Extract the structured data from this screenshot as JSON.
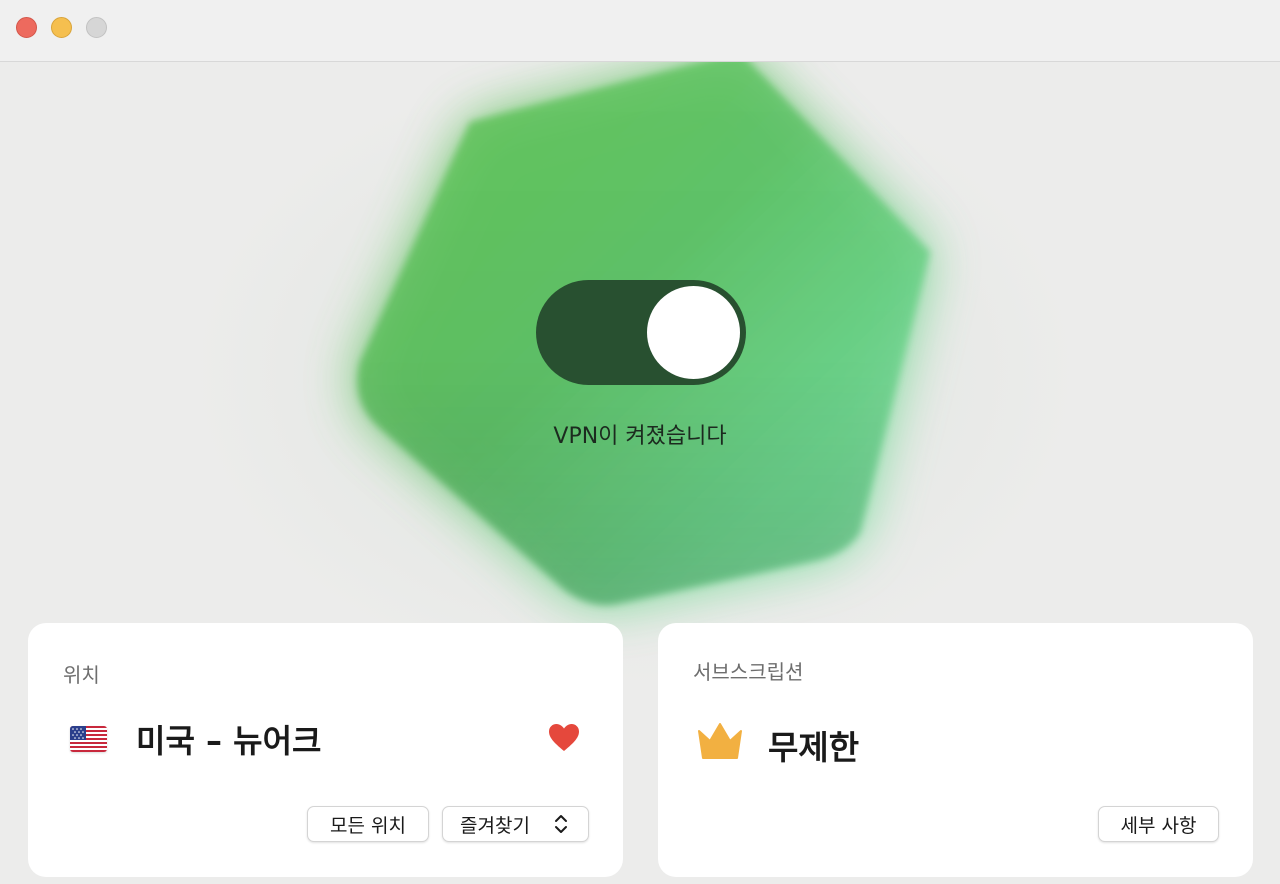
{
  "window": {
    "controls": [
      "close",
      "minimize",
      "zoom"
    ]
  },
  "vpn": {
    "toggle_state": "on",
    "status_text": "VPN이 켜졌습니다"
  },
  "location_card": {
    "label": "위치",
    "flag_icon": "us-flag-icon",
    "location_name": "미국 – 뉴어크",
    "favorite_icon": "heart-icon",
    "favorite_color": "#e5483c",
    "all_locations_button": "모든 위치",
    "favorites_button": "즐겨찾기"
  },
  "subscription_card": {
    "label": "서브스크립션",
    "plan_icon": "crown-icon",
    "plan_icon_color": "#f2b041",
    "plan_name": "무제한",
    "details_button": "세부 사항"
  },
  "colors": {
    "accent_green": "#5cc766",
    "toggle_track": "#285030"
  }
}
